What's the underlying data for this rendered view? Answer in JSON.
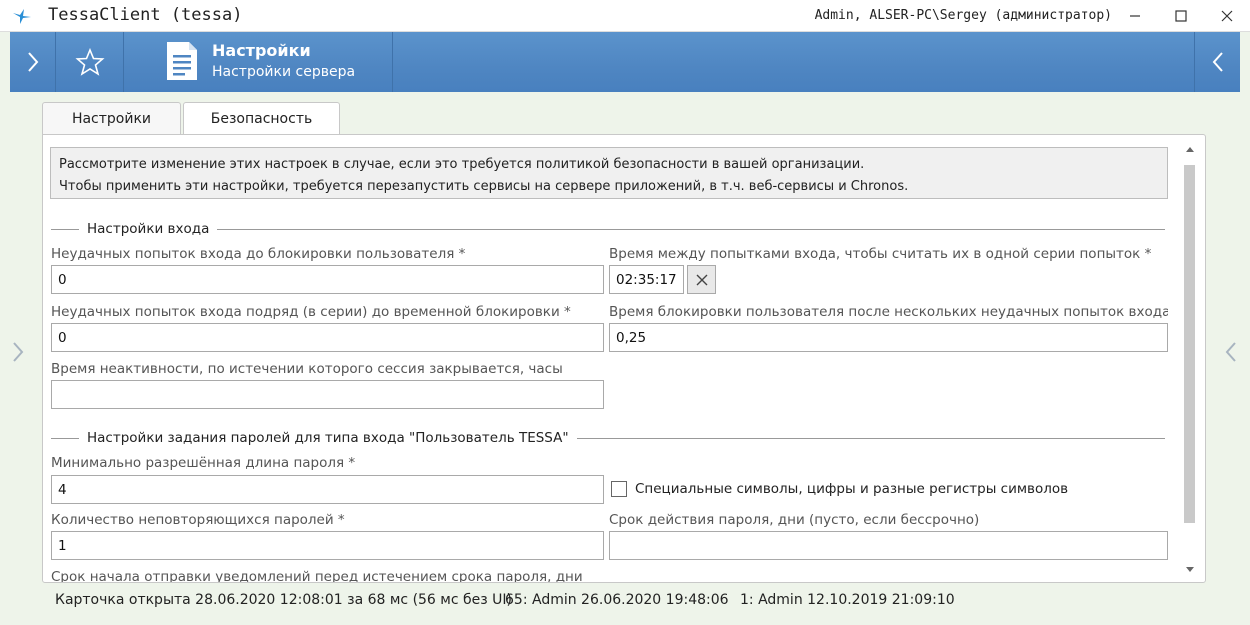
{
  "window": {
    "title": "TessaClient (tessa)",
    "user_info": "Admin, ALSER-PC\\Sergey (администратор)",
    "minimize_icon": "minimize-icon",
    "maximize_icon": "maximize-icon",
    "close_icon": "close-icon"
  },
  "header": {
    "title": "Настройки",
    "subtitle": "Настройки сервера",
    "accent": "#4f86c2"
  },
  "tabs": [
    {
      "label": "Настройки",
      "active": false
    },
    {
      "label": "Безопасность",
      "active": true
    }
  ],
  "info": {
    "line1": "Рассмотрите изменение этих настроек в случае, если это требуется политикой безопасности в вашей организации.",
    "line2": "Чтобы применить эти настройки, требуется перезапустить сервисы на сервере приложений, в т.ч. веб-сервисы и Chronos."
  },
  "login_section": {
    "title": "Настройки входа",
    "failed_attempts_label": "Неудачных попыток входа до блокировки пользователя  *",
    "failed_attempts_value": "0",
    "series_time_label": "Время между попытками входа, чтобы считать их в одной серии попыток  *",
    "series_time_value": "02:35:17",
    "consecutive_label": "Неудачных попыток входа подряд (в серии) до временной блокировки  *",
    "consecutive_value": "0",
    "lock_time_label": "Время блокировки пользователя после нескольких неудачных попыток входа подряд",
    "lock_time_value": "0,25",
    "inactivity_label": "Время неактивности, по истечении которого сессия закрывается, часы",
    "inactivity_value": ""
  },
  "password_section": {
    "title": "Настройки задания паролей для типа входа \"Пользователь TESSA\"",
    "min_length_label": "Минимально разрешённая длина пароля  *",
    "min_length_value": "4",
    "special_chars_label": "Специальные символы, цифры и разные регистры символов",
    "special_chars_checked": false,
    "unique_count_label": "Количество неповторяющихся паролей  *",
    "unique_count_value": "1",
    "expiry_label": "Срок действия пароля, дни (пусто, если бессрочно)",
    "expiry_value": "",
    "notify_label": "Срок начала отправки уведомлений перед истечением срока пароля, дни"
  },
  "status": {
    "opened": "Карточка открыта 28.06.2020 12:08:01 за 68 мс (56 мс без UI)",
    "version": "65:  Admin  26.06.2020 19:48:06",
    "created": "1:  Admin  12.10.2019 21:09:10"
  }
}
